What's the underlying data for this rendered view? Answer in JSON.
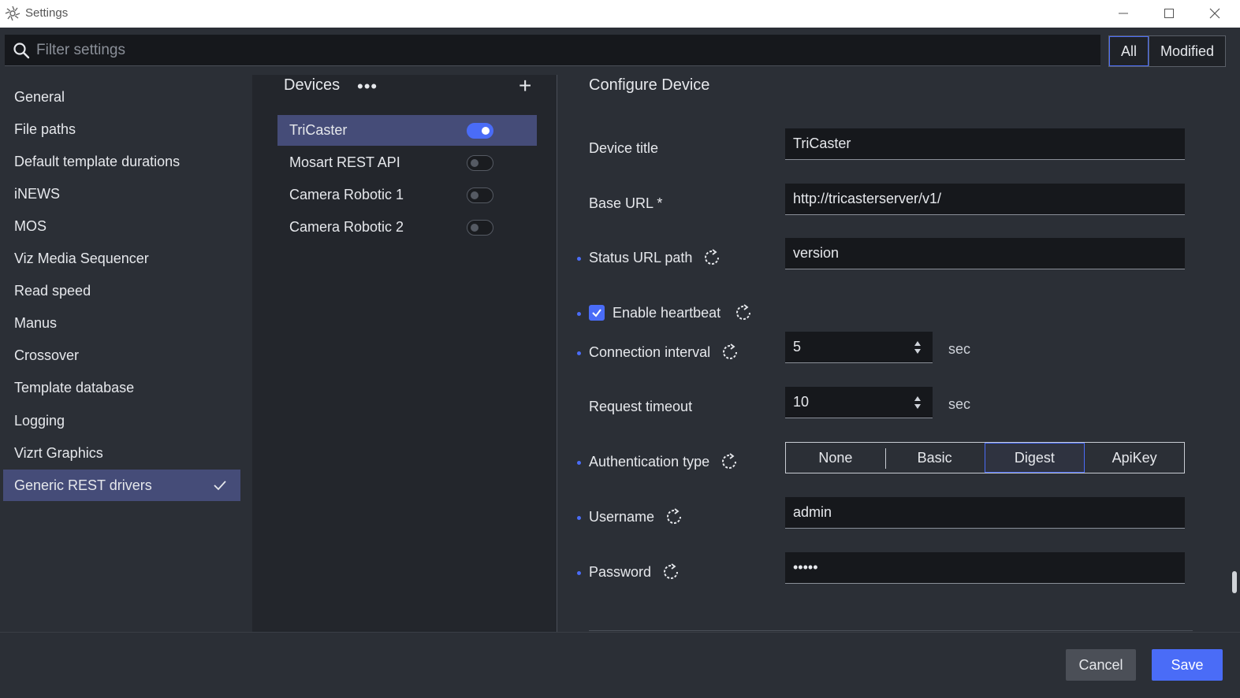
{
  "window": {
    "title": "Settings",
    "icon": "gear-flower-icon"
  },
  "filter": {
    "placeholder": "Filter settings",
    "value": "",
    "toggle_all": "All",
    "toggle_modified": "Modified",
    "active": "All"
  },
  "nav": {
    "items": [
      {
        "label": "General"
      },
      {
        "label": "File paths"
      },
      {
        "label": "Default template durations"
      },
      {
        "label": "iNEWS"
      },
      {
        "label": "MOS"
      },
      {
        "label": "Viz Media Sequencer"
      },
      {
        "label": "Read speed"
      },
      {
        "label": "Manus"
      },
      {
        "label": "Crossover"
      },
      {
        "label": "Template database"
      },
      {
        "label": "Logging"
      },
      {
        "label": "Vizrt Graphics"
      },
      {
        "label": "Generic REST drivers",
        "active": true
      }
    ]
  },
  "devices": {
    "heading": "Devices",
    "more_label": "•••",
    "add_label": "+",
    "items": [
      {
        "label": "TriCaster",
        "enabled": true,
        "active": true
      },
      {
        "label": "Mosart REST API",
        "enabled": false
      },
      {
        "label": "Camera Robotic 1",
        "enabled": false
      },
      {
        "label": "Camera Robotic 2",
        "enabled": false
      }
    ]
  },
  "config": {
    "heading": "Configure Device",
    "device_title": {
      "label": "Device title",
      "value": "TriCaster"
    },
    "base_url": {
      "label": "Base URL *",
      "value": "http://tricasterserver/v1/"
    },
    "status_url": {
      "label": "Status URL path",
      "value": "version"
    },
    "heartbeat": {
      "label": "Enable heartbeat",
      "checked": true
    },
    "connection_interval": {
      "label": "Connection interval",
      "value": "5",
      "unit": "sec"
    },
    "request_timeout": {
      "label": "Request timeout",
      "value": "10",
      "unit": "sec"
    },
    "auth": {
      "label": "Authentication type",
      "options": [
        "None",
        "Basic",
        "Digest",
        "ApiKey"
      ],
      "selected": "Digest"
    },
    "username": {
      "label": "Username",
      "value": "admin"
    },
    "password": {
      "label": "Password",
      "value": "•••••"
    }
  },
  "footer": {
    "cancel_label": "Cancel",
    "save_label": "Save"
  },
  "colors": {
    "accent": "#4a6cf7",
    "active_row": "#454c78",
    "background": "#2b2f36",
    "field": "#16181c"
  }
}
